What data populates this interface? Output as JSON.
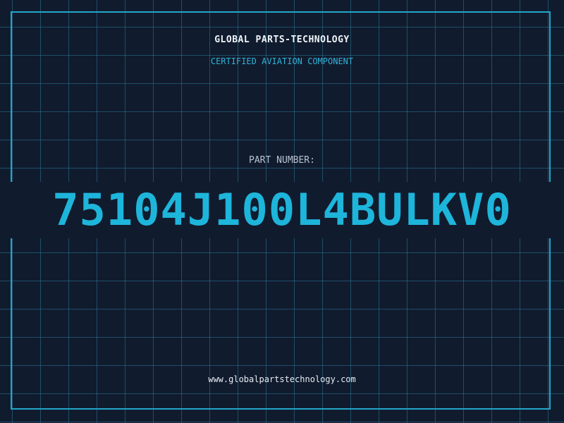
{
  "header": {
    "brand": "GLOBAL PARTS-TECHNOLOGY",
    "subtitle": "CERTIFIED AVIATION COMPONENT"
  },
  "part": {
    "label": "PART NUMBER:",
    "number": "75104J100L4BULKV0"
  },
  "footer": {
    "website": "www.globalpartstechnology.com"
  },
  "colors": {
    "background": "#111b2e",
    "grid": "#287896",
    "accent": "#1eb5db",
    "frame": "#22a6c8",
    "label": "#b7c4d1",
    "text": "#eef4f8"
  }
}
